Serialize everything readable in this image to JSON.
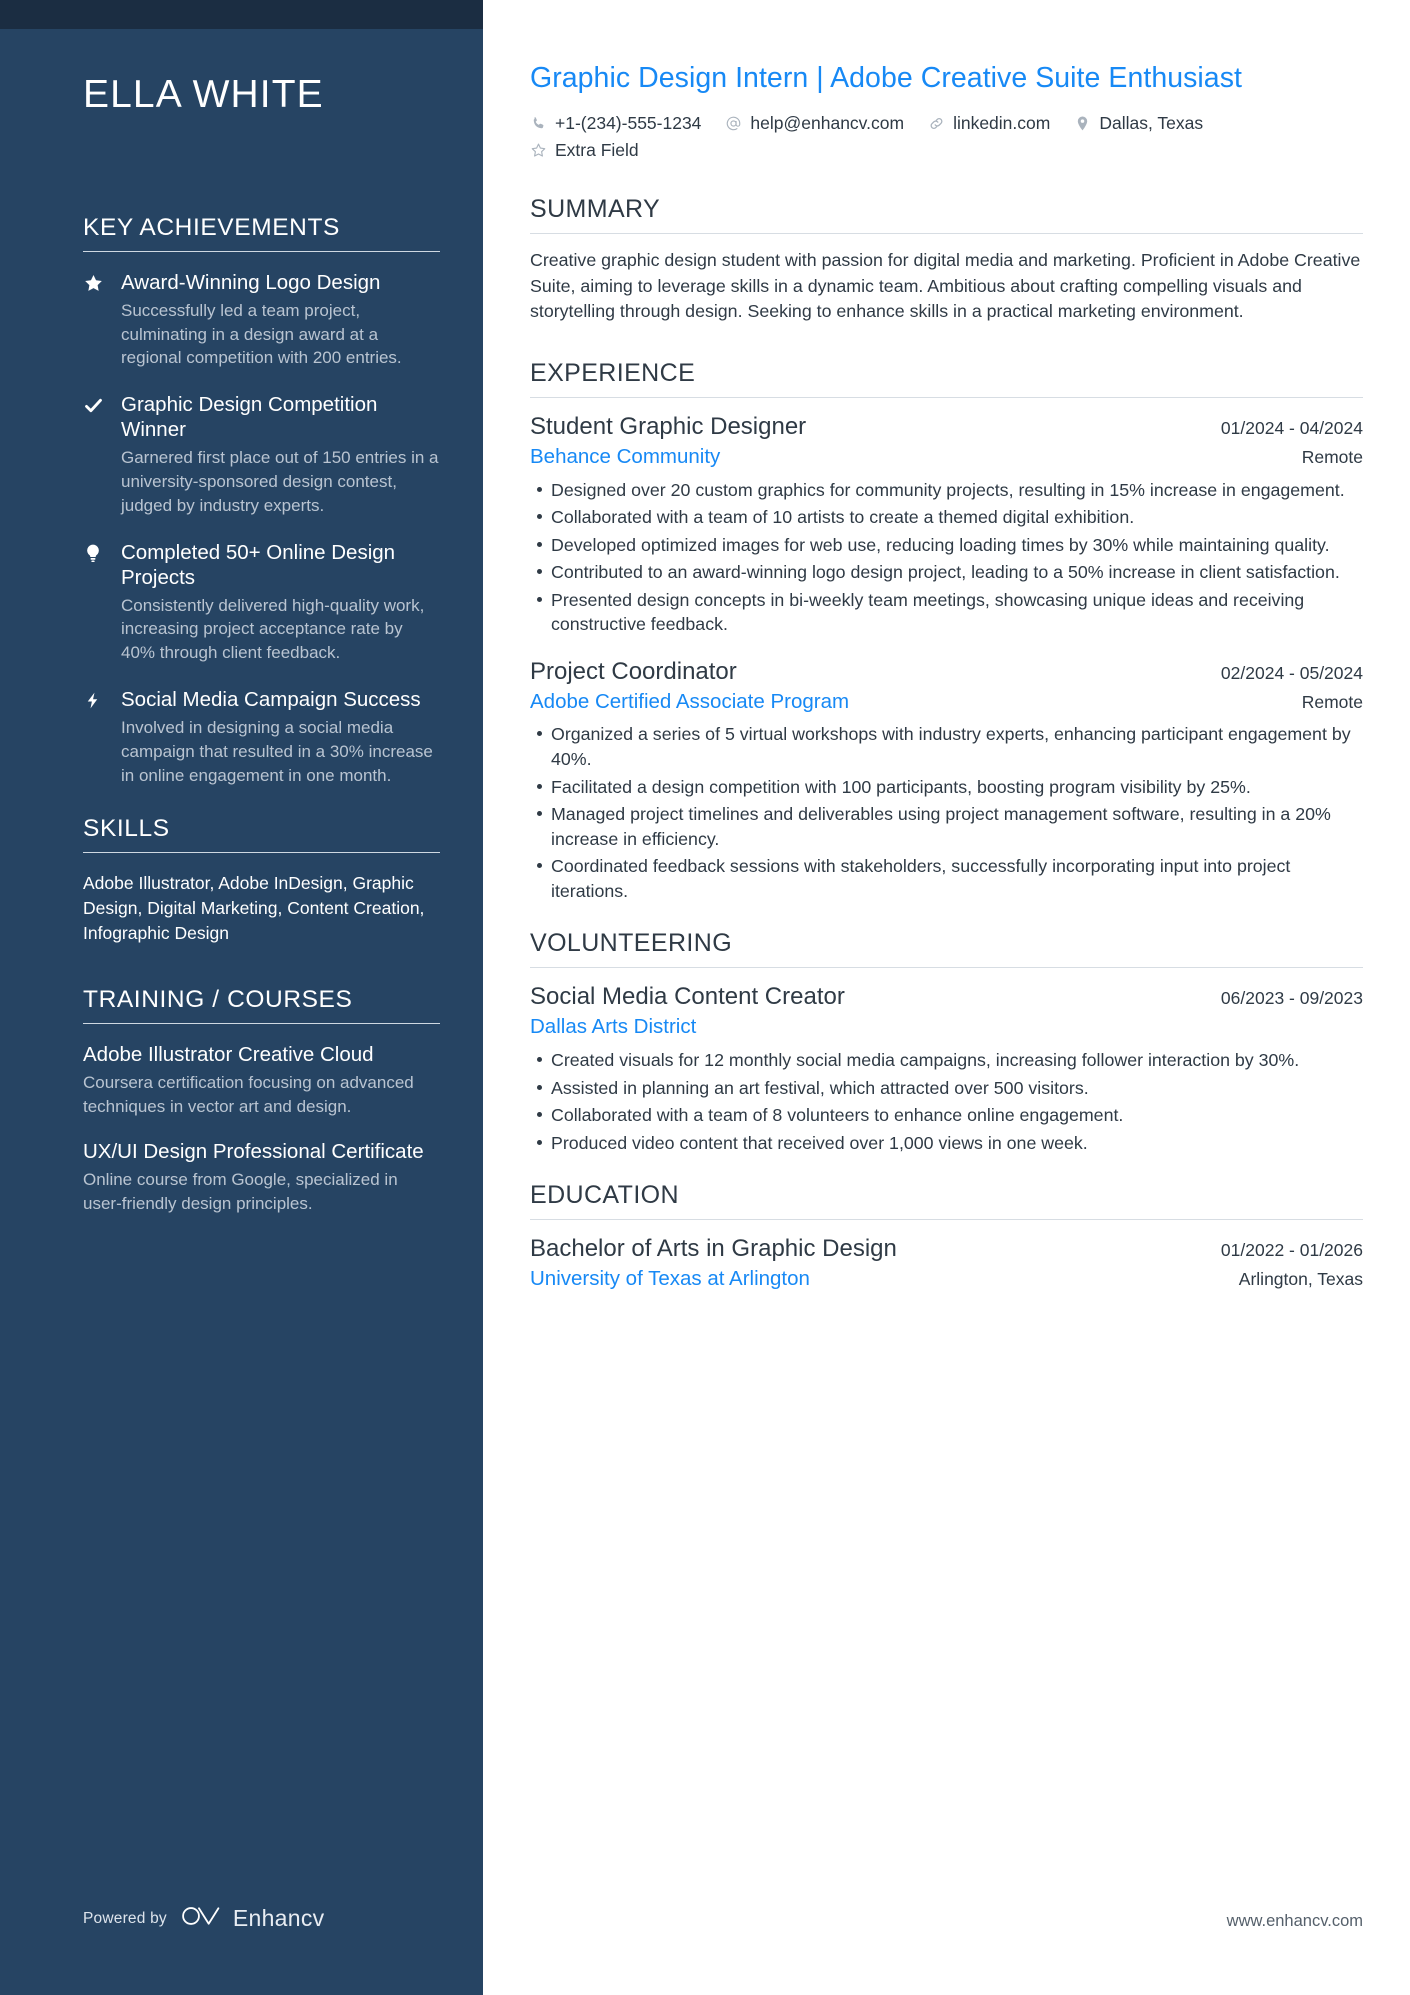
{
  "colors": {
    "sidebar_bg": "#264463",
    "sidebar_topbar": "#1b2d42",
    "accent_blue": "#1789f5",
    "body_text": "#2f3a45",
    "muted_sidebar_text": "#b9c4d1"
  },
  "sidebar": {
    "name": "ELLA WHITE",
    "achievements_title": "KEY ACHIEVEMENTS",
    "achievements": [
      {
        "icon": "star-icon",
        "title": "Award-Winning Logo Design",
        "description": "Successfully led a team project, culminating in a design award at a regional competition with 200 entries."
      },
      {
        "icon": "check-icon",
        "title": "Graphic Design Competition Winner",
        "description": "Garnered first place out of 150 entries in a university-sponsored design contest, judged by industry experts."
      },
      {
        "icon": "lightbulb-icon",
        "title": "Completed 50+ Online Design Projects",
        "description": "Consistently delivered high-quality work, increasing project acceptance rate by 40% through client feedback."
      },
      {
        "icon": "lightning-bolt-icon",
        "title": "Social Media Campaign Success",
        "description": "Involved in designing a social media campaign that resulted in a 30% increase in online engagement in one month."
      }
    ],
    "skills_title": "SKILLS",
    "skills_text": "Adobe Illustrator, Adobe InDesign, Graphic Design, Digital Marketing, Content Creation, Infographic Design",
    "training_title": "TRAINING / COURSES",
    "training": [
      {
        "name": "Adobe Illustrator Creative Cloud",
        "description": "Coursera certification focusing on advanced techniques in vector art and design."
      },
      {
        "name": "UX/UI Design Professional Certificate",
        "description": "Online course from Google, specialized in user-friendly design principles."
      }
    ],
    "footer": {
      "powered_by": "Powered by",
      "brand": "Enhancv"
    }
  },
  "main": {
    "headline": "Graphic Design Intern | Adobe Creative Suite Enthusiast",
    "contacts": [
      {
        "icon": "phone-icon",
        "text": "+1-(234)-555-1234"
      },
      {
        "icon": "at-sign-icon",
        "text": "help@enhancv.com"
      },
      {
        "icon": "link-icon",
        "text": "linkedin.com"
      },
      {
        "icon": "map-pin-icon",
        "text": "Dallas, Texas"
      },
      {
        "icon": "star-outline-icon",
        "text": "Extra Field"
      }
    ],
    "summary": {
      "title": "SUMMARY",
      "text": "Creative graphic design student with passion for digital media and marketing. Proficient in Adobe Creative Suite, aiming to leverage skills in a dynamic team. Ambitious about crafting compelling visuals and storytelling through design. Seeking to enhance skills in a practical marketing environment."
    },
    "experience": {
      "title": "EXPERIENCE",
      "entries": [
        {
          "title": "Student Graphic Designer",
          "date": "01/2024 - 04/2024",
          "organization": "Behance Community",
          "location": "Remote",
          "bullets": [
            "Designed over 20 custom graphics for community projects, resulting in 15% increase in engagement.",
            "Collaborated with a team of 10 artists to create a themed digital exhibition.",
            "Developed optimized images for web use, reducing loading times by 30% while maintaining quality.",
            "Contributed to an award-winning logo design project, leading to a 50% increase in client satisfaction.",
            "Presented design concepts in bi-weekly team meetings, showcasing unique ideas and receiving constructive feedback."
          ]
        },
        {
          "title": "Project Coordinator",
          "date": "02/2024 - 05/2024",
          "organization": "Adobe Certified Associate Program",
          "location": "Remote",
          "bullets": [
            "Organized a series of 5 virtual workshops with industry experts, enhancing participant engagement by 40%.",
            "Facilitated a design competition with 100 participants, boosting program visibility by 25%.",
            "Managed project timelines and deliverables using project management software, resulting in a 20% increase in efficiency.",
            "Coordinated feedback sessions with stakeholders, successfully incorporating input into project iterations."
          ]
        }
      ]
    },
    "volunteering": {
      "title": "VOLUNTEERING",
      "entries": [
        {
          "title": "Social Media Content Creator",
          "date": "06/2023 - 09/2023",
          "organization": "Dallas Arts District",
          "location": "",
          "bullets": [
            "Created visuals for 12 monthly social media campaigns, increasing follower interaction by 30%.",
            "Assisted in planning an art festival, which attracted over 500 visitors.",
            "Collaborated with a team of 8 volunteers to enhance online engagement.",
            "Produced video content that received over 1,000 views in one week."
          ]
        }
      ]
    },
    "education": {
      "title": "EDUCATION",
      "entries": [
        {
          "title": "Bachelor of Arts in Graphic Design",
          "date": "01/2022 - 01/2026",
          "organization": "University of Texas at Arlington",
          "location": "Arlington, Texas",
          "bullets": []
        }
      ]
    },
    "footer_url": "www.enhancv.com"
  }
}
